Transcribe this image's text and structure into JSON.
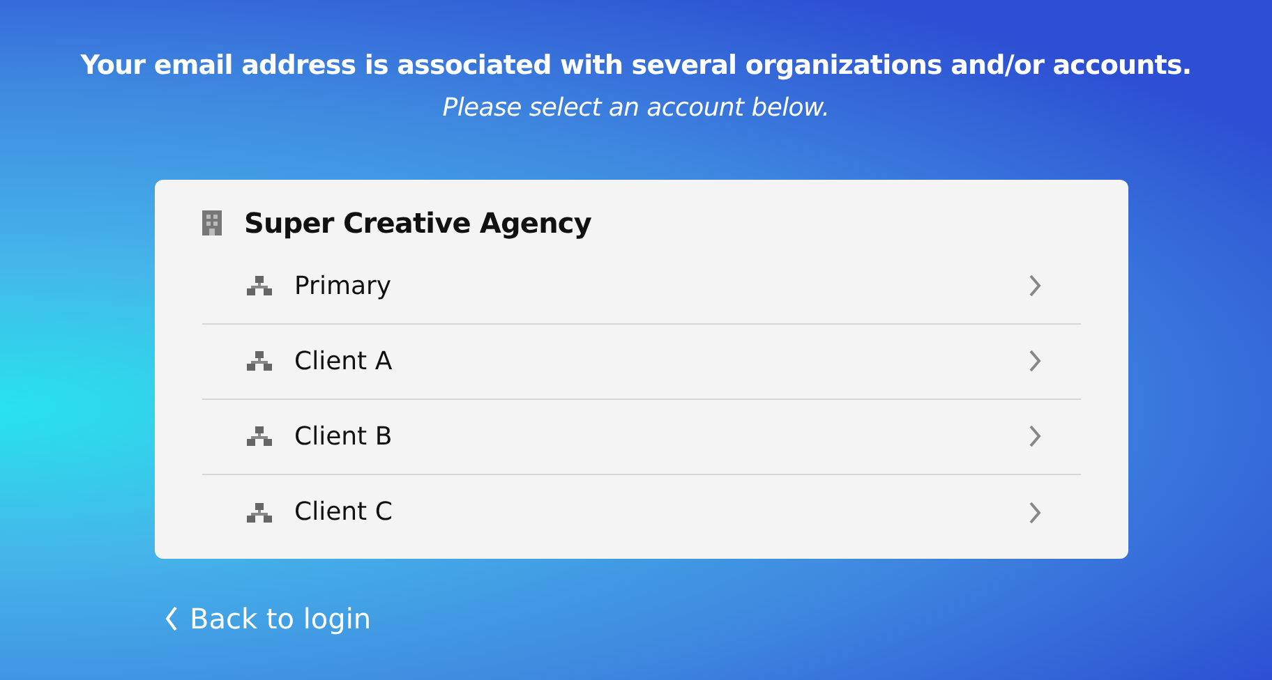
{
  "heading": "Your email address is associated with several organizations and/or accounts.",
  "subheading": "Please select an account below.",
  "organization": {
    "name": "Super Creative Agency",
    "accounts": [
      {
        "name": "Primary"
      },
      {
        "name": "Client A"
      },
      {
        "name": "Client B"
      },
      {
        "name": "Client C"
      }
    ]
  },
  "back_link": "Back to login"
}
